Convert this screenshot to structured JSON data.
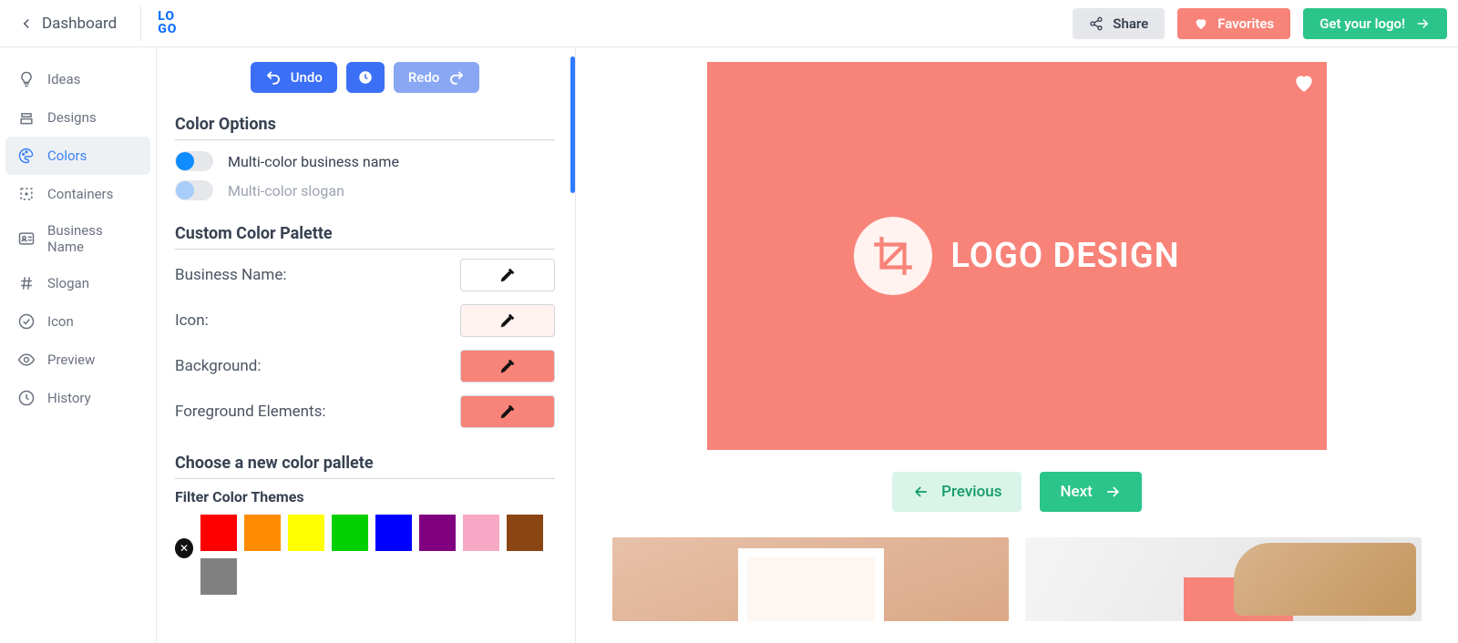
{
  "header": {
    "back_label": "Dashboard",
    "brand_top": "LO",
    "brand_bot": "GO",
    "share_label": "Share",
    "favorites_label": "Favorites",
    "cta_label": "Get your logo!"
  },
  "sidebar": {
    "items": [
      {
        "label": "Ideas",
        "icon": "bulb"
      },
      {
        "label": "Designs",
        "icon": "stack"
      },
      {
        "label": "Colors",
        "icon": "palette",
        "active": true
      },
      {
        "label": "Containers",
        "icon": "bounding"
      },
      {
        "label": "Business Name",
        "icon": "id"
      },
      {
        "label": "Slogan",
        "icon": "hash"
      },
      {
        "label": "Icon",
        "icon": "check"
      },
      {
        "label": "Preview",
        "icon": "eye"
      },
      {
        "label": "History",
        "icon": "clock"
      }
    ]
  },
  "panel": {
    "undo_label": "Undo",
    "redo_label": "Redo",
    "section_color_options": "Color Options",
    "toggles": [
      {
        "label": "Multi-color business name",
        "on": true
      },
      {
        "label": "Multi-color slogan",
        "on": false,
        "disabled": true
      }
    ],
    "section_custom_palette": "Custom Color Palette",
    "custom_rows": [
      {
        "label": "Business Name:",
        "color": "#ffffff"
      },
      {
        "label": "Icon:",
        "color": "#fff2ef"
      },
      {
        "label": "Background:",
        "color": "#f88379"
      },
      {
        "label": "Foreground Elements:",
        "color": "#f88379"
      }
    ],
    "section_choose": "Choose a new color pallete",
    "filter_title": "Filter Color Themes",
    "filter_colors": [
      "#ff0000",
      "#ff8c00",
      "#ffff00",
      "#00d000",
      "#0000ff",
      "#800080",
      "#f7a8c4",
      "#8b4513",
      "#808080"
    ]
  },
  "preview": {
    "logo_text": "LOGO DESIGN",
    "prev_label": "Previous",
    "next_label": "Next"
  }
}
